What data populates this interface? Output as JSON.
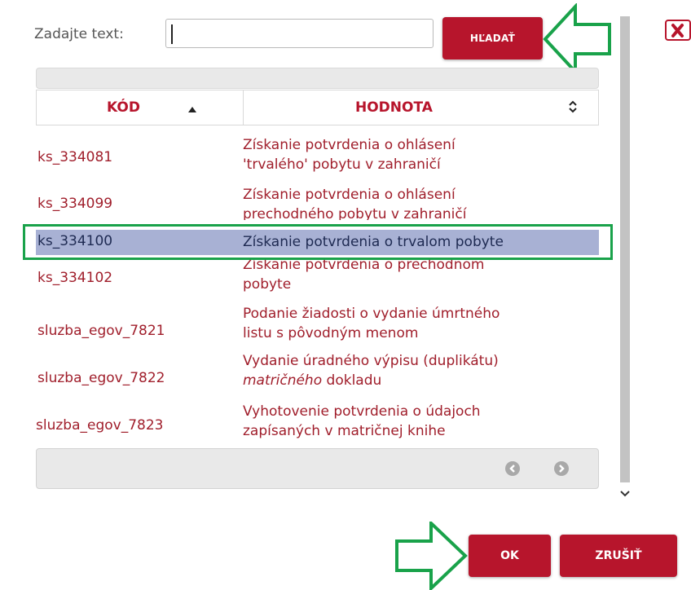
{
  "search": {
    "label": "Zadajte text:",
    "value": "",
    "button_label": "HĽADAŤ"
  },
  "table": {
    "columns": [
      {
        "label": "KÓD",
        "sort": "ascending"
      },
      {
        "label": "HODNOTA",
        "sort": "none"
      }
    ],
    "rows": [
      {
        "code": "ks_334081",
        "line1": "Získanie potvrdenia o ohlásení",
        "line2": "'trvalého' pobytu v zahraničí"
      },
      {
        "code": "ks_334099",
        "line1": "Získanie potvrdenia o ohlásení",
        "line2": "prechodného pobytu v zahraničí"
      },
      {
        "code": "ks_334100",
        "line1": "Získanie potvrdenia o trvalom pobyte",
        "selected": true
      },
      {
        "code": "ks_334102",
        "line1": "Získanie potvrdenia o prechodnom",
        "line2": "pobyte"
      },
      {
        "code": "sluzba_egov_7821",
        "line1": "Podanie žiadosti o vydanie úmrtného",
        "line2": "listu s pôvodným menom"
      },
      {
        "code": "sluzba_egov_7822",
        "line1": "Vydanie úradného výpisu (duplikátu)",
        "line2_italic": "matričného",
        "line2_rest": " dokladu"
      },
      {
        "code": "sluzba_egov_7823",
        "line1": "Vyhotovenie potvrdenia o údajoch",
        "line2": "zapísaných v matričnej knihe"
      }
    ]
  },
  "icons": {
    "close": "close-icon",
    "prev": "prev-page-icon",
    "next": "next-page-icon",
    "scroll_up": "chevron-up-icon",
    "scroll_down": "chevron-down-icon",
    "sort_up": "sort-ascending-icon",
    "sort_both": "sort-both-icon",
    "arrow": "green-arrow-icon"
  },
  "colors": {
    "accent": "#b7152c",
    "text_red": "#a01e2b",
    "highlight_row": "#a8b1d4",
    "annotation_green": "#19a24a"
  },
  "actions": {
    "ok_label": "OK",
    "cancel_label": "ZRUŠIŤ"
  }
}
